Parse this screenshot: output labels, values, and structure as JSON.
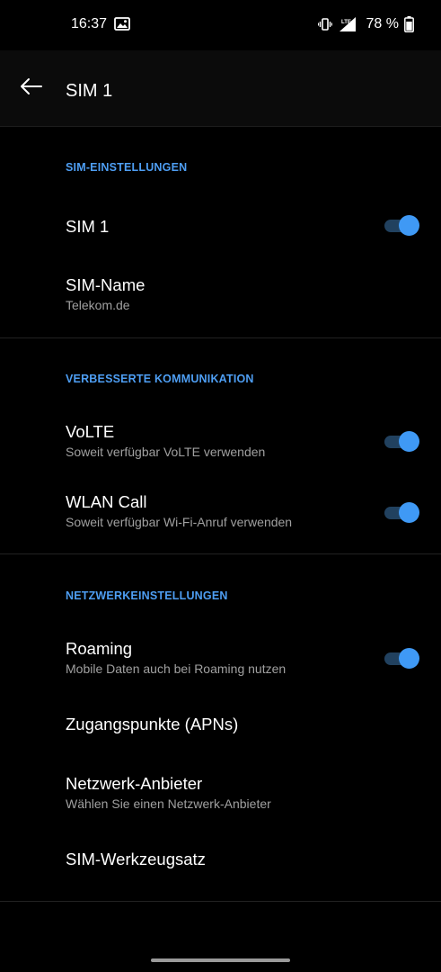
{
  "status_bar": {
    "time": "16:37",
    "gallery_icon": "gallery-icon",
    "vibrate_icon": "vibrate-icon",
    "network_type": "LTE",
    "signal_icon": "signal-icon",
    "battery_percent": "78 %",
    "battery_icon": "battery-icon"
  },
  "app_bar": {
    "back_icon": "arrow-back-icon",
    "title": "SIM 1"
  },
  "sections": {
    "sim_settings": {
      "header": "SIM-EINSTELLUNGEN",
      "sim_toggle": {
        "title": "SIM 1",
        "enabled": true
      },
      "sim_name": {
        "title": "SIM-Name",
        "subtitle": "Telekom.de"
      }
    },
    "enhanced_communication": {
      "header": "VERBESSERTE KOMMUNIKATION",
      "volte": {
        "title": "VoLTE",
        "subtitle": "Soweit verfügbar VoLTE verwenden",
        "enabled": true
      },
      "wlan_call": {
        "title": "WLAN Call",
        "subtitle": "Soweit verfügbar Wi-Fi-Anruf verwenden",
        "enabled": true
      }
    },
    "network_settings": {
      "header": "NETZWERKEINSTELLUNGEN",
      "roaming": {
        "title": "Roaming",
        "subtitle": "Mobile Daten auch bei Roaming nutzen",
        "enabled": true
      },
      "apn": {
        "title": "Zugangspunkte (APNs)"
      },
      "network_operator": {
        "title": "Netzwerk-Anbieter",
        "subtitle": "Wählen Sie einen Netzwerk-Anbieter"
      },
      "sim_toolkit": {
        "title": "SIM-Werkzeugsatz"
      }
    }
  },
  "colors": {
    "background": "#000000",
    "accent": "#3f99f5",
    "section_header": "#4e9ef3",
    "secondary_text": "#a0a0a0"
  }
}
